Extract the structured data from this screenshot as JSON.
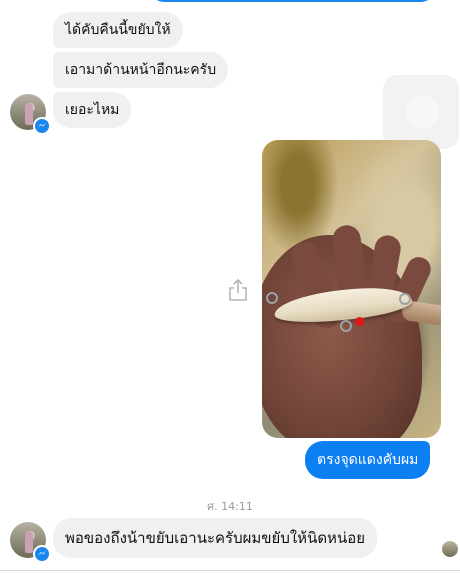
{
  "messages": {
    "incoming_1": "ได้คับคืนนี้ขยับให้",
    "incoming_2": "เอามาด้านหน้าอีกนะครับ",
    "incoming_3": "เยอะไหม",
    "outgoing_1": "ตรงจุดแดงคับผม",
    "incoming_4": "พอของถึงน้าขยับเอานะครับผมขยับให้นิดหน่อย"
  },
  "timestamp": "ศ. 14:11",
  "icons": {
    "share": "share-icon",
    "messenger_badge": "messenger-badge-icon",
    "avatar": "avatar"
  },
  "colors": {
    "outgoing_bubble": "#0c7ff2",
    "incoming_bubble": "#f0f0f0",
    "messenger_blue": "#1a86f0"
  }
}
